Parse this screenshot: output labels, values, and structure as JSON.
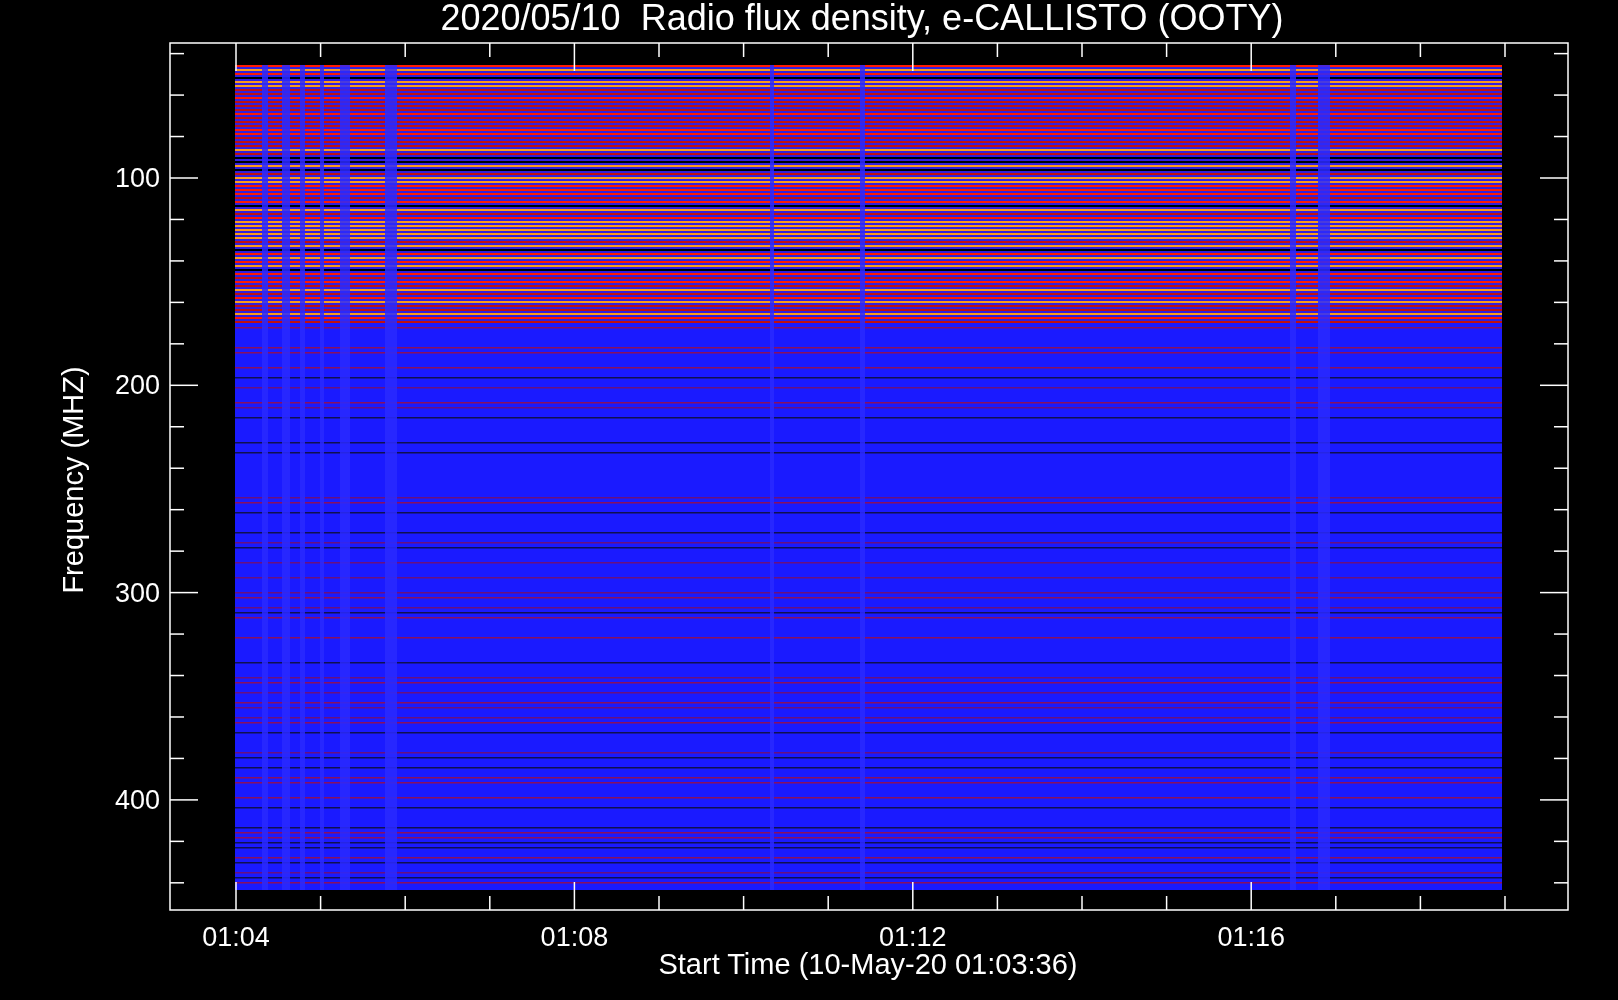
{
  "chart": {
    "title": "2020/05/10  Radio flux density, e-CALLISTO (OOTY)",
    "xlabel": "Start Time (10-May-20 01:03:36)",
    "ylabel": "Frequency (MHZ)",
    "xticks": [
      "01:04",
      "01:08",
      "01:12",
      "01:16"
    ],
    "yticks": [
      "100",
      "200",
      "300",
      "400"
    ]
  }
}
